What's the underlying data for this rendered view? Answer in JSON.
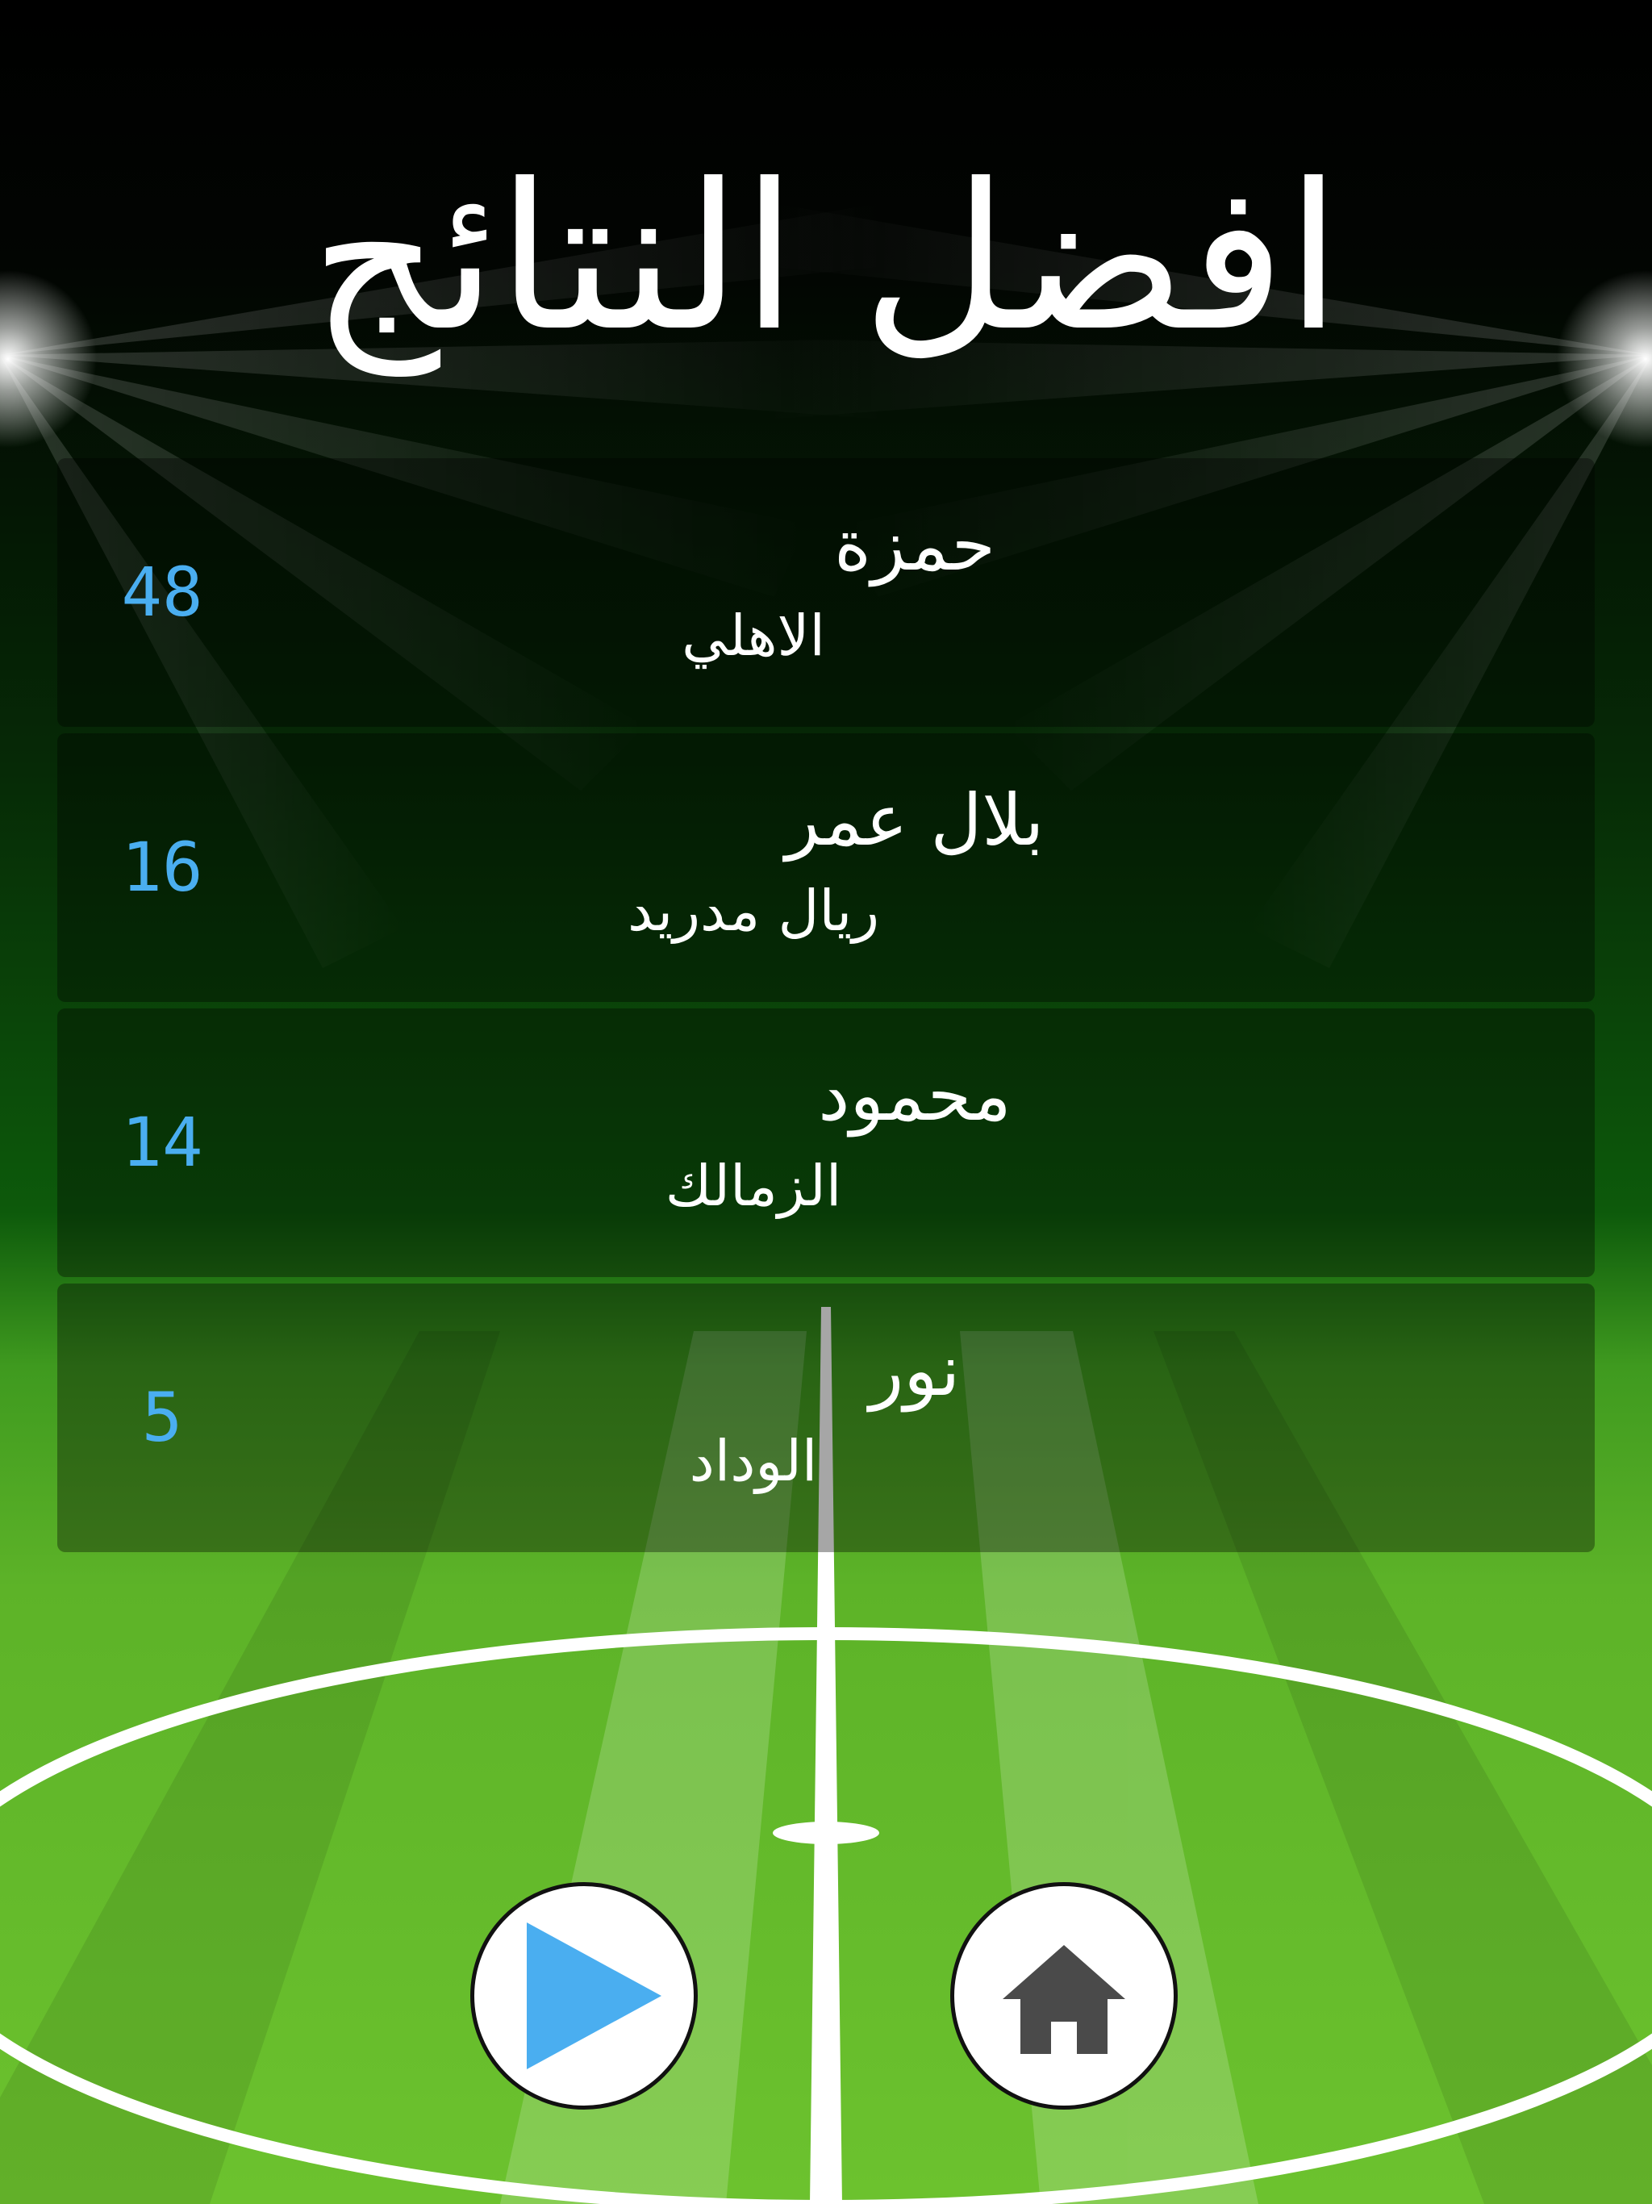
{
  "title": "افضل النتائج",
  "colors": {
    "sky_top": "#000000",
    "grass_dark": "#0a3d08",
    "grass_light": "#6fbf2f",
    "points": "#4aaef0",
    "play_icon": "#4aaef0",
    "home_icon": "#4a4a4a"
  },
  "scores": [
    {
      "points": "48",
      "player": "حمزة",
      "team": "الاهلي"
    },
    {
      "points": "16",
      "player": "بلال عمر",
      "team": "ريال مدريد"
    },
    {
      "points": "14",
      "player": "محمود",
      "team": "الزمالك"
    },
    {
      "points": "5",
      "player": "نور",
      "team": "الوداد"
    }
  ],
  "buttons": {
    "play_icon": "play-icon",
    "home_icon": "home-icon"
  }
}
